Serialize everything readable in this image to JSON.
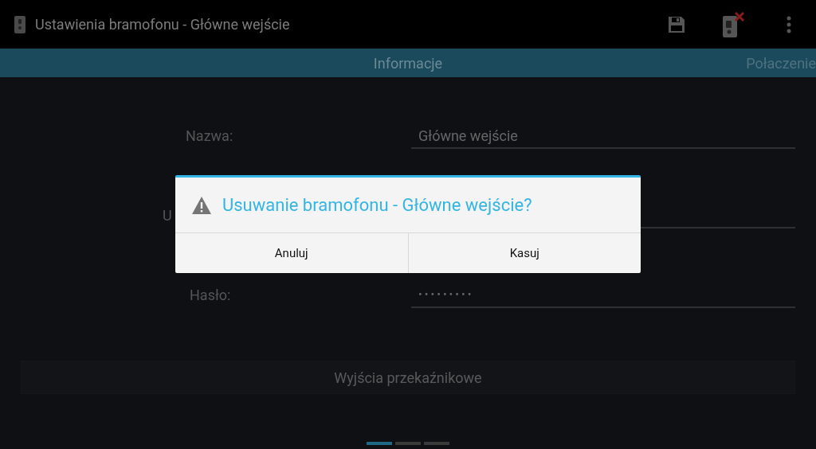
{
  "action_bar": {
    "title": "Ustawienia bramofonu - Główne wejście"
  },
  "tabs": [
    {
      "label": "Informacje",
      "selected": true
    },
    {
      "label": "Połaczenie",
      "selected": false
    }
  ],
  "form": {
    "rows": [
      {
        "label": "Nazwa:",
        "kind": "text",
        "value": "Główne wejście"
      },
      {
        "label": "U"
      },
      {
        "label": "Hasło:",
        "kind": "password",
        "value": "•••••••••"
      }
    ],
    "relay_button": "Wyjścia przekaźnikowe"
  },
  "page_indicator": [
    {
      "selected": true
    },
    {
      "selected": false
    },
    {
      "selected": false
    }
  ],
  "dialog": {
    "title": "Usuwanie bramofonu - Główne wejście?",
    "buttons": [
      "Anuluj",
      "Kasuj"
    ]
  }
}
